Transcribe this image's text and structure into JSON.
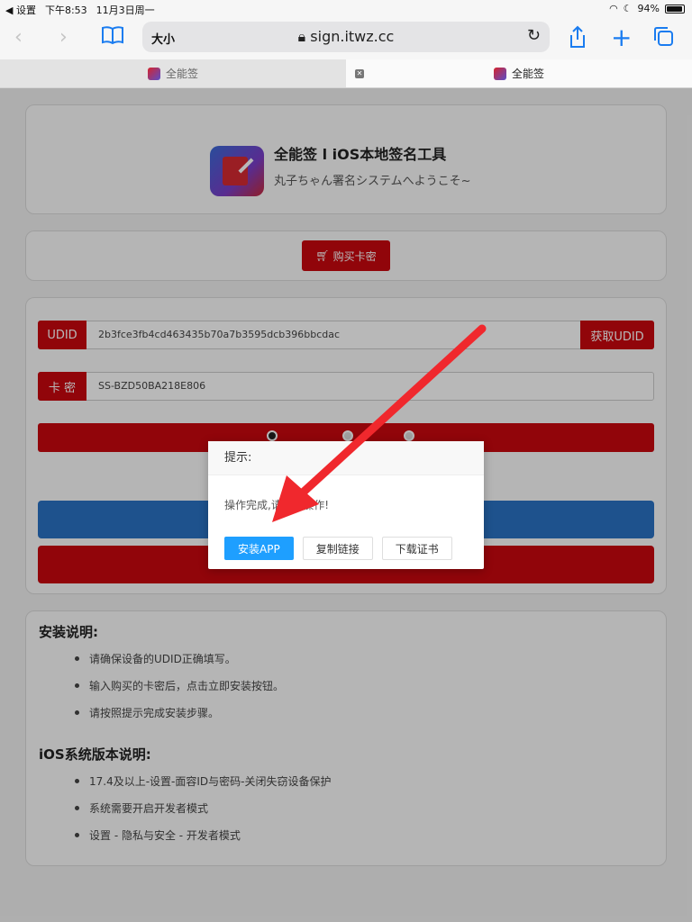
{
  "status_bar": {
    "back_label": "◀ 设置",
    "time": "下午8:53",
    "date": "11月3日周一",
    "battery_text": "94%",
    "battery_level": 0.94
  },
  "browser": {
    "reader_label": "大小",
    "url": "sign.itwz.cc",
    "tabs": [
      {
        "label": "全能签",
        "active": false
      },
      {
        "label": "全能签",
        "active": true
      }
    ]
  },
  "header": {
    "title": "全能签 l iOS本地签名工具",
    "subtitle": "丸子ちゃん署名システムへようこそ~"
  },
  "buy": {
    "label": "购买卡密"
  },
  "form": {
    "udid_label": "UDID",
    "udid_value": "2b3fce3fb4cd463435b70a7b3595dcb396bbcdac",
    "get_udid_label": "获取UDID",
    "card_label": "卡 密",
    "card_value": "SS-BZD50BA218E806"
  },
  "dialog": {
    "title": "提示:",
    "message": "操作完成,请...装操作!",
    "buttons": [
      "安装APP",
      "复制链接",
      "下载证书"
    ]
  },
  "install_notes": {
    "title": "安装说明:",
    "items": [
      "请确保设备的UDID正确填写。",
      "输入购买的卡密后，点击立即安装按钮。",
      "请按照提示完成安装步骤。"
    ]
  },
  "ios_notes": {
    "title": "iOS系统版本说明:",
    "items": [
      "17.4及以上-设置-面容ID与密码-关闭失窃设备保护",
      "系统需要开启开发者模式",
      "设置 - 隐私与安全 - 开发者模式"
    ]
  },
  "colors": {
    "brand_red": "#c9080f",
    "dialog_primary": "#1e9fff",
    "arrow": "#f0282d"
  }
}
